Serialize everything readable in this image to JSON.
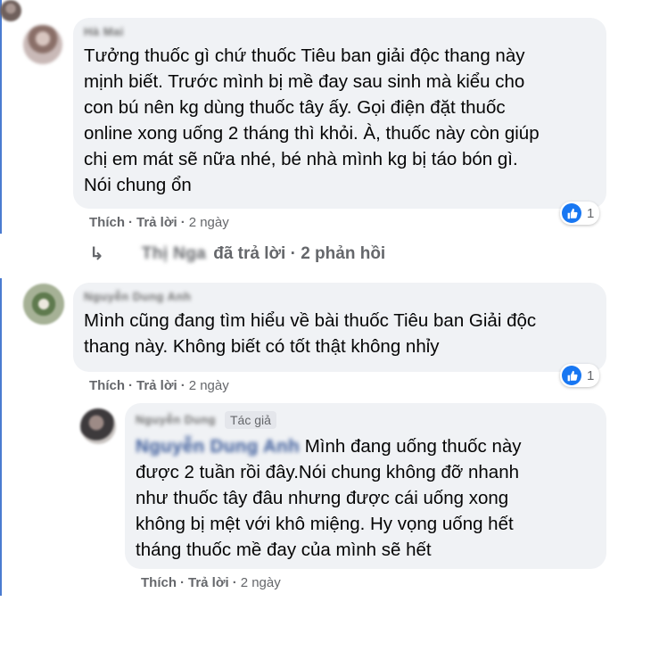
{
  "comments": [
    {
      "author": "Hà Mai",
      "text": "Tưởng thuốc gì chứ thuốc Tiêu ban giải độc thang này\nmịnh biết. Trước mình bị mề đay sau sinh mà kiểu cho\ncon bú nên kg dùng thuốc tây ấy. Gọi điện đặt thuốc\nonline xong uống 2 tháng thì khỏi. À, thuốc này còn giúp\nchị em mát sẽ nữa nhé, bé nhà mình kg bị táo bón gì.\nNói chung ổn",
      "like_label": "Thích",
      "reply_label": "Trả lời",
      "time": "2 ngày",
      "reaction_count": "1",
      "replies_summary": {
        "name": "Thị Nga",
        "text": "đã trả lời · 2 phản hồi"
      }
    },
    {
      "author": "Nguyễn Dung Anh",
      "text": "Mình cũng đang tìm hiểu về bài thuốc Tiêu ban Giải độc\nthang này. Không biết có tốt thật không nhỉy",
      "like_label": "Thích",
      "reply_label": "Trả lời",
      "time": "2 ngày",
      "reaction_count": "1"
    }
  ],
  "reply": {
    "author": "Nguyễn Dung",
    "role": "Tác giả",
    "mention": "Nguyễn Dung Anh",
    "text": " Mình đang uống thuốc này\nđược 2 tuần rồi đây.Nói chung không đỡ nhanh\nnhư thuốc tây đâu nhưng được cái uống xong\nkhông bị mệt với khô miệng. Hy vọng uống hết\ntháng thuốc mề đay của mình sẽ hết",
    "like_label": "Thích",
    "reply_label": "Trả lời",
    "time": "2 ngày"
  },
  "colors": {
    "bubble": "#f0f2f5",
    "meta_text": "#65676b",
    "like_blue": "#1877f2",
    "thread_line": "#4a7bd0"
  },
  "icons": [
    "thumbs-up-icon",
    "reply-arrow-icon"
  ]
}
